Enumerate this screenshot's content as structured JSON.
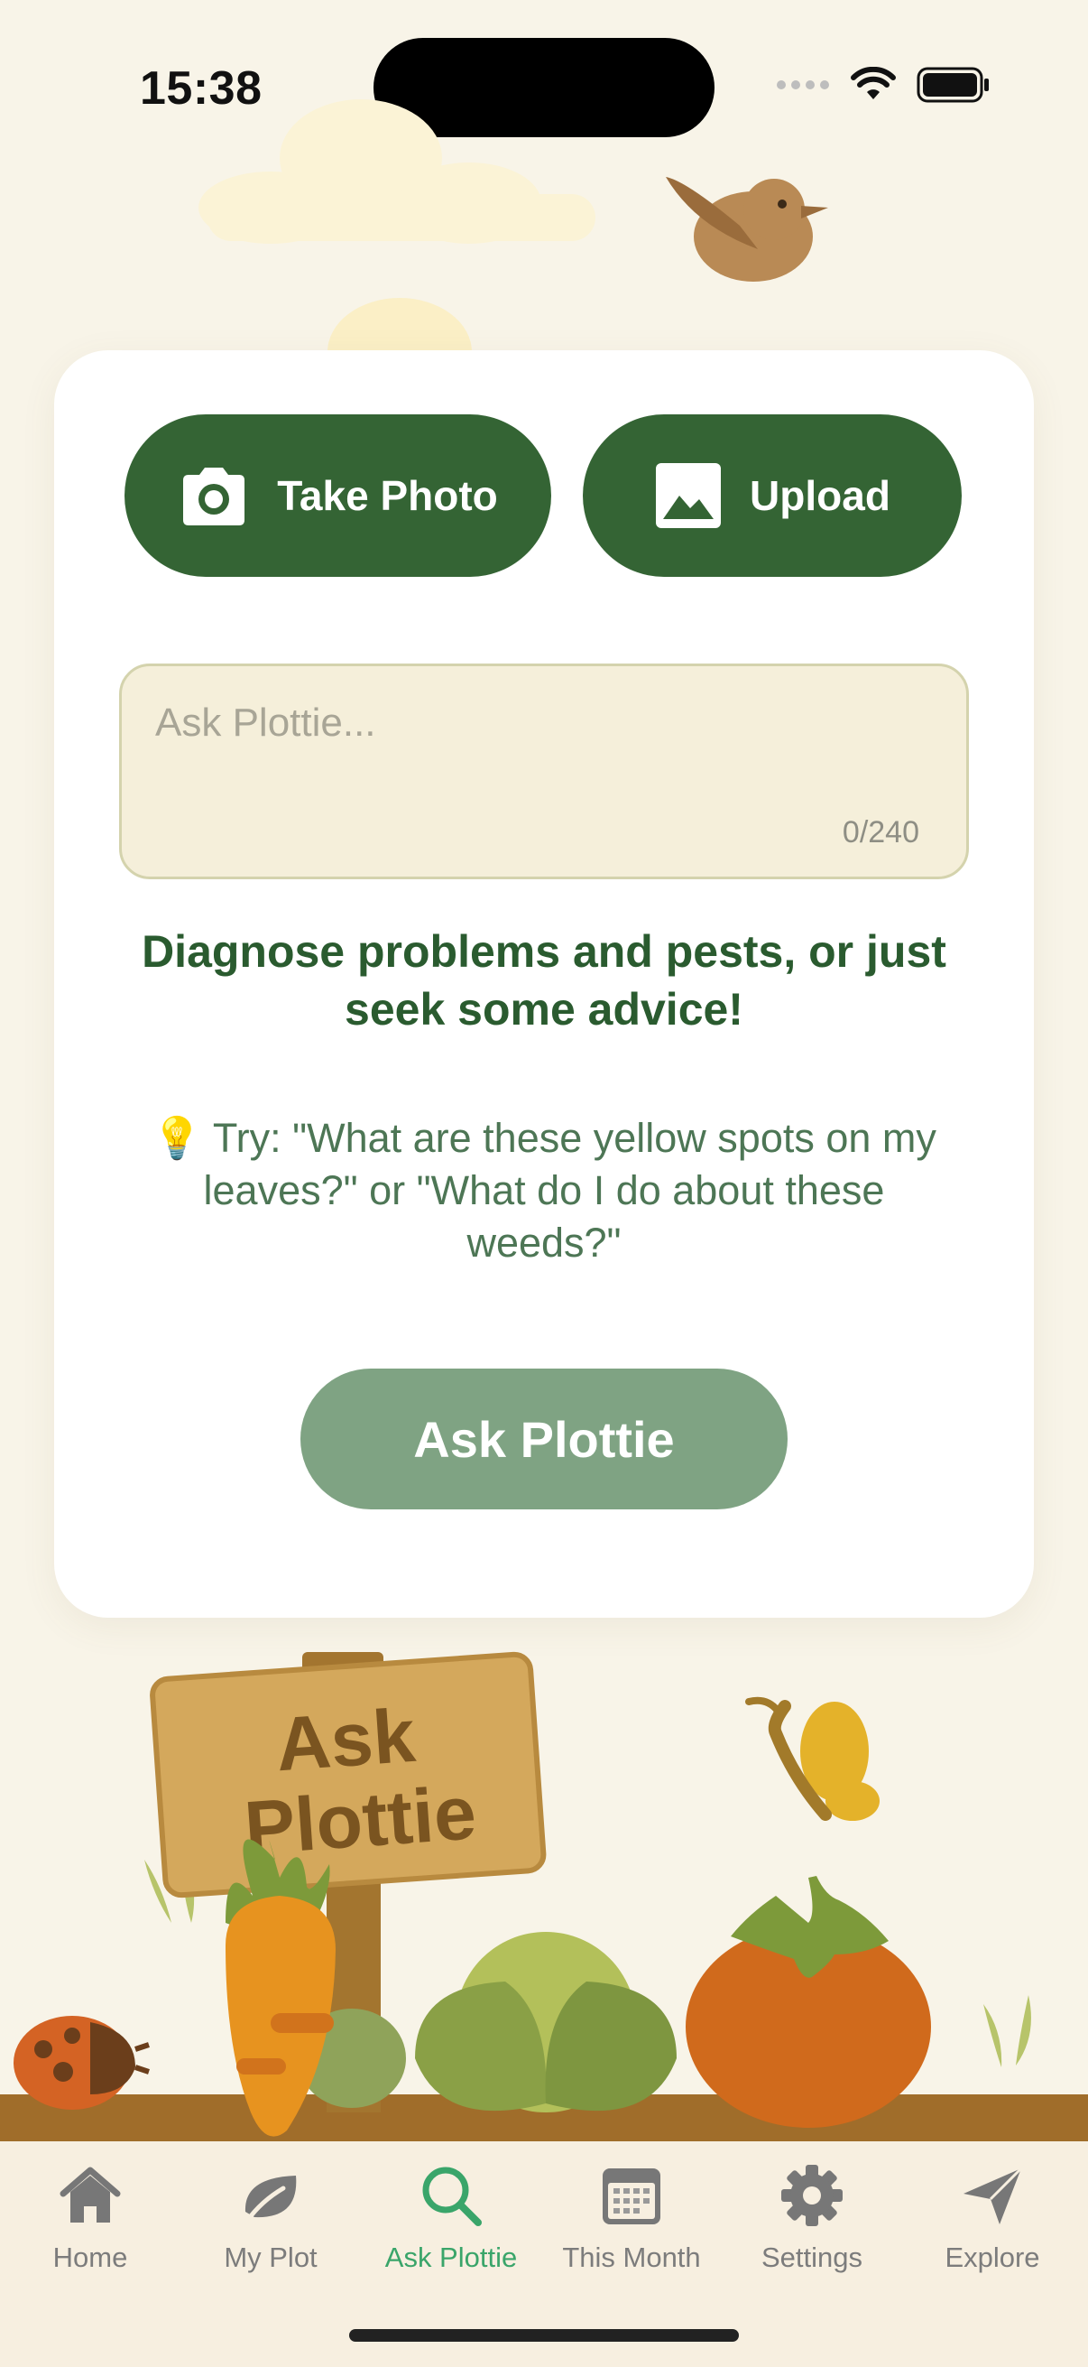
{
  "status": {
    "time": "15:38"
  },
  "actions": {
    "take_photo": "Take Photo",
    "upload": "Upload"
  },
  "ask": {
    "placeholder": "Ask Plottie...",
    "counter": "0/240",
    "value": ""
  },
  "headline": "Diagnose problems and pests, or just seek some advice!",
  "tip": "💡 Try: \"What are these yellow spots on my leaves?\" or \"What do I do about these weeds?\"",
  "submit_label": "Ask Plottie",
  "sign": {
    "line1": "Ask",
    "line2": "Plottie"
  },
  "tabs": [
    {
      "label": "Home",
      "icon": "house-icon"
    },
    {
      "label": "My Plot",
      "icon": "leaf-icon"
    },
    {
      "label": "Ask Plottie",
      "icon": "search-icon",
      "active": true
    },
    {
      "label": "This Month",
      "icon": "calendar-icon"
    },
    {
      "label": "Settings",
      "icon": "gear-icon"
    },
    {
      "label": "Explore",
      "icon": "paper-plane-icon"
    }
  ],
  "colors": {
    "primary": "#346434",
    "accent": "#3aa56a",
    "background": "#f8f4e8"
  }
}
